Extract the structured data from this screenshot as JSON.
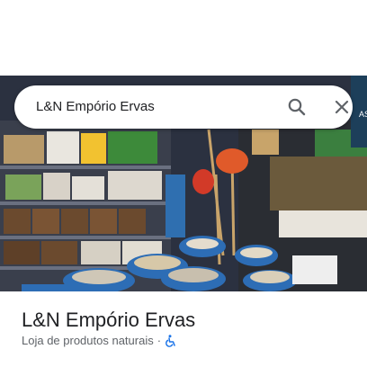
{
  "search": {
    "query": "L&N Empório Ervas"
  },
  "place": {
    "name": "L&N Empório Ervas",
    "category": "Loja de produtos naturais",
    "separator": "·"
  },
  "icons": {
    "search": "search-icon",
    "close": "close-icon",
    "accessibility": "wheelchair-accessible-icon"
  },
  "colors": {
    "accessibility_icon": "#1a73e8",
    "text_primary": "#202124",
    "text_secondary": "#5f6368"
  },
  "photo": {
    "storefront_sign_fragment": "AS"
  }
}
